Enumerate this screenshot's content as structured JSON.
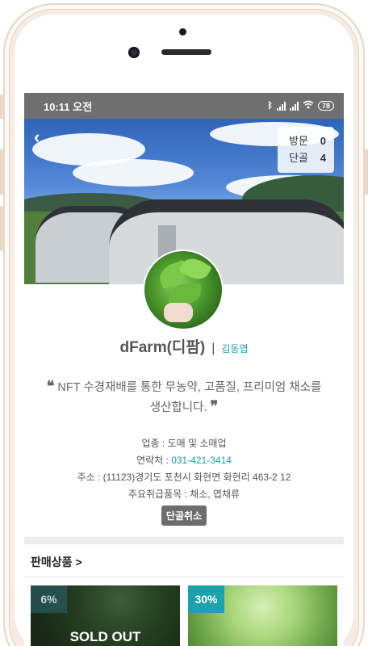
{
  "status_bar": {
    "time": "10:11 오전",
    "battery": "78"
  },
  "banner": {
    "visit_label": "방문",
    "visit_count": "0",
    "regular_label": "단골",
    "regular_count": "4"
  },
  "profile": {
    "farm_name": "dFarm(디팜)",
    "separator": "|",
    "owner": "김동엽",
    "quote": "NFT 수경재배를 통한 무농약, 고품질, 프리미엄 채소를 생산합니다.",
    "quote_open": "❝",
    "quote_close": "❞",
    "business_type": "업종 : 도매 및 소매업",
    "contact_label": "연락처 : ",
    "contact_value": "031-421-3414",
    "address": "주소 : (11123)경기도 포천시 화현면 화현리 463-2 12",
    "main_items": "주요취급품목 : 채소, 엽채류",
    "unfollow_label": "단골취소"
  },
  "products_section": {
    "title": "판매상품 >",
    "items": [
      {
        "discount": "6%",
        "status": "SOLD OUT"
      },
      {
        "discount": "30%",
        "status": ""
      }
    ]
  },
  "colors": {
    "accent": "#1a9fa8",
    "status_bar": "#6f6f6f",
    "button": "#6d6d6d"
  }
}
